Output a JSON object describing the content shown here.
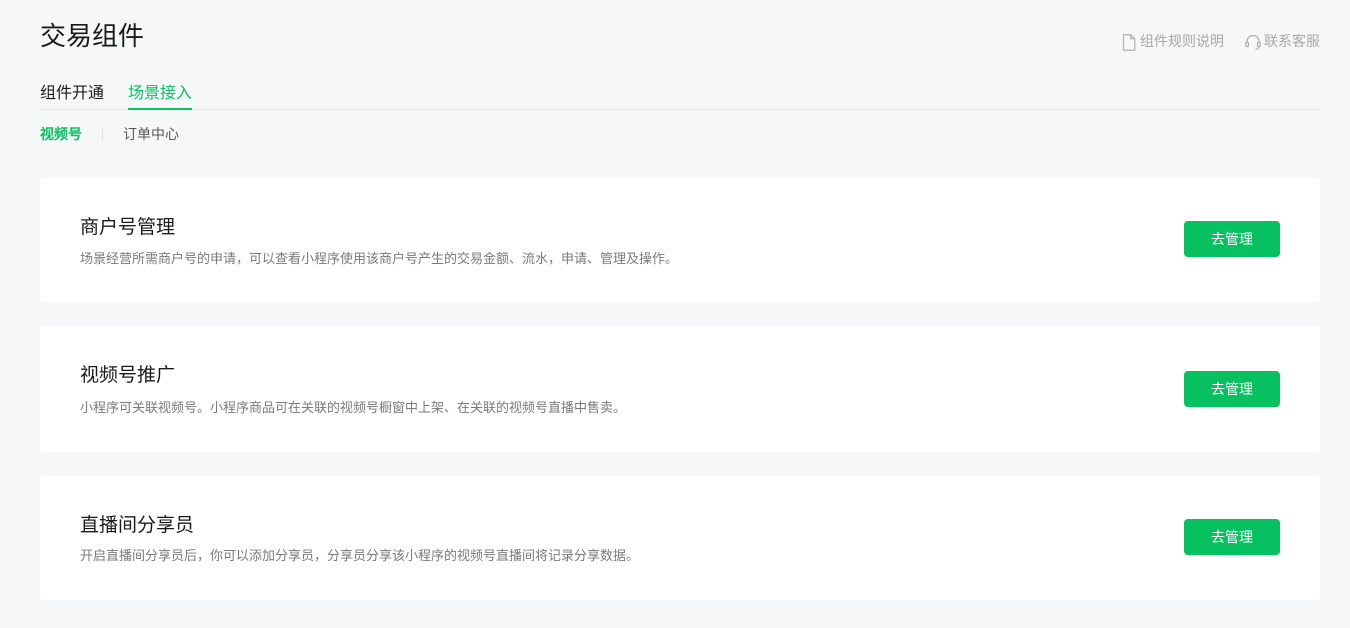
{
  "page": {
    "title": "交易组件"
  },
  "header_actions": [
    {
      "label": "组件规则说明",
      "icon": "document-icon"
    },
    {
      "label": "联系客服",
      "icon": "headset-icon"
    }
  ],
  "tabs": [
    {
      "label": "组件开通",
      "active": false
    },
    {
      "label": "场景接入",
      "active": true
    }
  ],
  "subtabs": [
    {
      "label": "视频号",
      "active": true
    },
    {
      "label": "订单中心",
      "active": false
    }
  ],
  "cards": [
    {
      "title": "商户号管理",
      "description": "场景经营所需商户号的申请，可以查看小程序使用该商户号产生的交易金额、流水，申请、管理及操作。",
      "button": "去管理"
    },
    {
      "title": "视频号推广",
      "description": "小程序可关联视频号。小程序商品可在关联的视频号橱窗中上架、在关联的视频号直播中售卖。",
      "button": "去管理"
    },
    {
      "title": "直播间分享员",
      "description": "开启直播间分享员后，你可以添加分享员，分享员分享该小程序的视频号直播间将记录分享数据。",
      "button": "去管理"
    }
  ],
  "colors": {
    "accent": "#07c160",
    "background": "#f6f7f9",
    "card": "#ffffff",
    "muted_text": "#7a7a7a"
  }
}
